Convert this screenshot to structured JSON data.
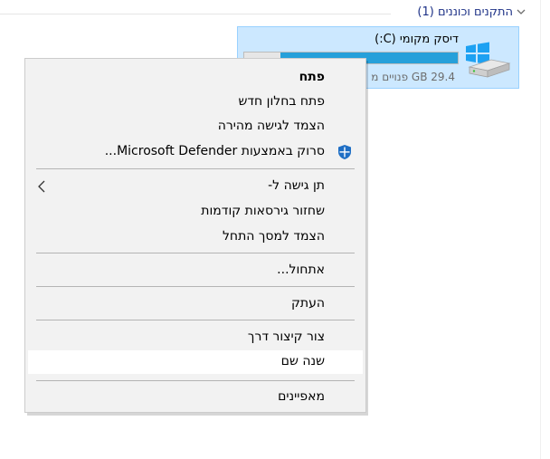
{
  "group": {
    "title": "התקנים וכוננים (1)",
    "chevron_icon": "chevron-down-icon"
  },
  "drive": {
    "name": "דיסק מקומי (C:)",
    "free_space": "29.4 GB פנויים מ",
    "used_fraction": 0.83,
    "bar_color": "#26a0da",
    "icon": "windows-drive-icon"
  },
  "context_menu": {
    "open": "פתח",
    "open_new_window": "פתח בחלון חדש",
    "pin_quick_access": "הצמד לגישה מהירה",
    "scan_defender": "סרוק באמצעות Microsoft Defender...",
    "defender_icon": "defender-shield-icon",
    "give_access": "תן גישה ל-",
    "restore_versions": "שחזור גירסאות קודמות",
    "pin_start": "הצמד למסך התחל",
    "format": "אתחול...",
    "copy": "העתק",
    "create_shortcut": "צור קיצור דרך",
    "rename": "שנה שם",
    "properties": "מאפיינים"
  },
  "colors": {
    "tile_bg": "#cce8ff",
    "tile_border": "#99d1ff",
    "menu_bg": "#f2f2f2",
    "hover_bg": "#ffffff",
    "header_text": "#1e3287"
  }
}
